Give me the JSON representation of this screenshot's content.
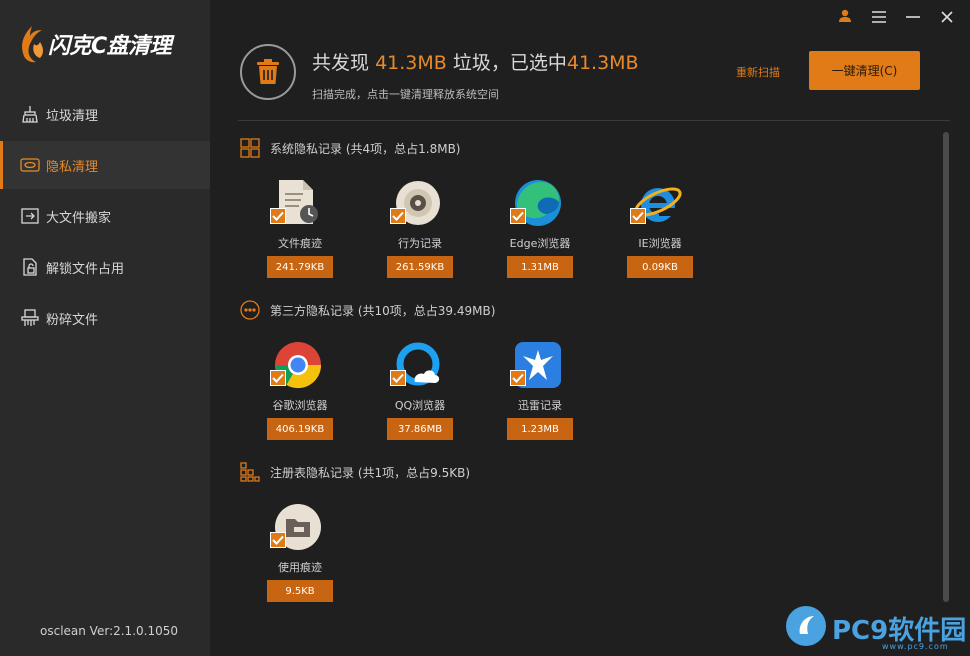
{
  "app": {
    "logo_text": "闪克C盘清理",
    "version": "osclean Ver:2.1.0.1050"
  },
  "sidebar": {
    "items": [
      {
        "label": "垃圾清理",
        "icon": "broom-icon",
        "active": false
      },
      {
        "label": "隐私清理",
        "icon": "privacy-icon",
        "active": true
      },
      {
        "label": "大文件搬家",
        "icon": "move-file-icon",
        "active": false
      },
      {
        "label": "解锁文件占用",
        "icon": "unlock-file-icon",
        "active": false
      },
      {
        "label": "粉碎文件",
        "icon": "shredder-icon",
        "active": false
      }
    ]
  },
  "window": {
    "icons": [
      "user-icon",
      "menu-icon",
      "minimize-icon",
      "close-icon"
    ]
  },
  "header": {
    "title_prefix": "共发现",
    "found_size": "41.3MB",
    "title_mid": "垃圾，已选中",
    "selected_size": "41.3MB",
    "subtitle": "扫描完成，点击一键清理释放系统空间",
    "rescan_label": "重新扫描",
    "clean_label": "一键清理(C)"
  },
  "sections": [
    {
      "title": "系统隐私记录 (共4项，总占1.8MB)",
      "icon": "grid-icon",
      "items": [
        {
          "name": "文件痕迹",
          "size": "241.79KB",
          "icon": "file-trace-icon"
        },
        {
          "name": "行为记录",
          "size": "261.59KB",
          "icon": "disc-icon"
        },
        {
          "name": "Edge浏览器",
          "size": "1.31MB",
          "icon": "edge-icon"
        },
        {
          "name": "IE浏览器",
          "size": "0.09KB",
          "icon": "ie-icon"
        }
      ]
    },
    {
      "title": "第三方隐私记录 (共10项，总占39.49MB)",
      "icon": "more-circle-icon",
      "items": [
        {
          "name": "谷歌浏览器",
          "size": "406.19KB",
          "icon": "chrome-icon"
        },
        {
          "name": "QQ浏览器",
          "size": "37.86MB",
          "icon": "qq-browser-icon"
        },
        {
          "name": "迅雷记录",
          "size": "1.23MB",
          "icon": "thunder-icon"
        }
      ]
    },
    {
      "title": "注册表隐私记录 (共1项，总占9.5KB)",
      "icon": "registry-icon",
      "items": [
        {
          "name": "使用痕迹",
          "size": "9.5KB",
          "icon": "usage-trace-icon"
        }
      ]
    }
  ],
  "watermark": {
    "text": "PC9软件园",
    "sub": "www.pc9.com"
  },
  "colors": {
    "accent": "#e07b18",
    "size_badge": "#c86512",
    "background": "#1f1f1f",
    "sidebar": "#2a2a2a"
  }
}
